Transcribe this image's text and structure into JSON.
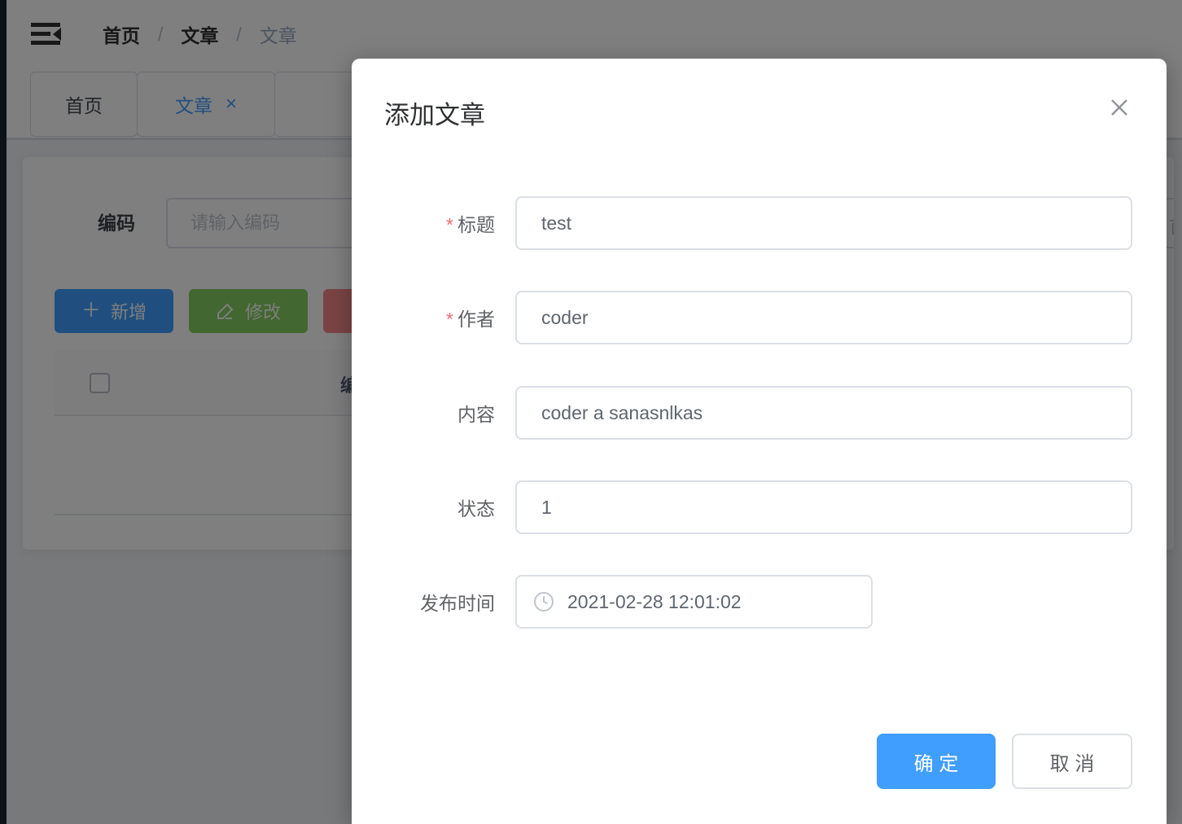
{
  "navbar": {
    "breadcrumb": {
      "items": [
        "首页",
        "文章",
        "文章"
      ],
      "separator": "/"
    }
  },
  "tabbar": {
    "tabs": [
      {
        "label": "首页",
        "active": false,
        "closable": false
      },
      {
        "label": "文章",
        "active": true,
        "closable": true
      }
    ]
  },
  "search_panel": {
    "code_label": "编码",
    "code_placeholder": "请输入编码",
    "second_field_fragment": "首"
  },
  "toolbar": {
    "add_label": "新增",
    "edit_label": "修改"
  },
  "table": {
    "first_column_header": "编码"
  },
  "dialog": {
    "title": "添加文章",
    "required_mark": "*",
    "fields": [
      {
        "label": "标题",
        "required": true,
        "value": "test"
      },
      {
        "label": "作者",
        "required": true,
        "value": "coder"
      },
      {
        "label": "内容",
        "required": false,
        "value": "coder a sanasnlkas"
      },
      {
        "label": "状态",
        "required": false,
        "value": "1"
      },
      {
        "label": "发布时间",
        "required": false,
        "value": "2021-02-28 12:01:02"
      }
    ],
    "confirm_label": "确 定",
    "cancel_label": "取 消"
  },
  "icons": {
    "add": "＋",
    "tab_close": "×",
    "collapse_menu": "hamburger-fold-icon",
    "edit": "pencil-icon",
    "datetime": "clock-icon",
    "dialog_close": "x-icon"
  },
  "colors": {
    "primary": "#409eff",
    "success_disabled": "#85ce61",
    "danger_disabled": "#f78989",
    "overlay": "rgba(0,0,0,0.5)",
    "required": "#f56c6c",
    "breadcrumb_last": "#97a8be",
    "border": "#dcdfe6",
    "sidebar": "#16222e"
  }
}
